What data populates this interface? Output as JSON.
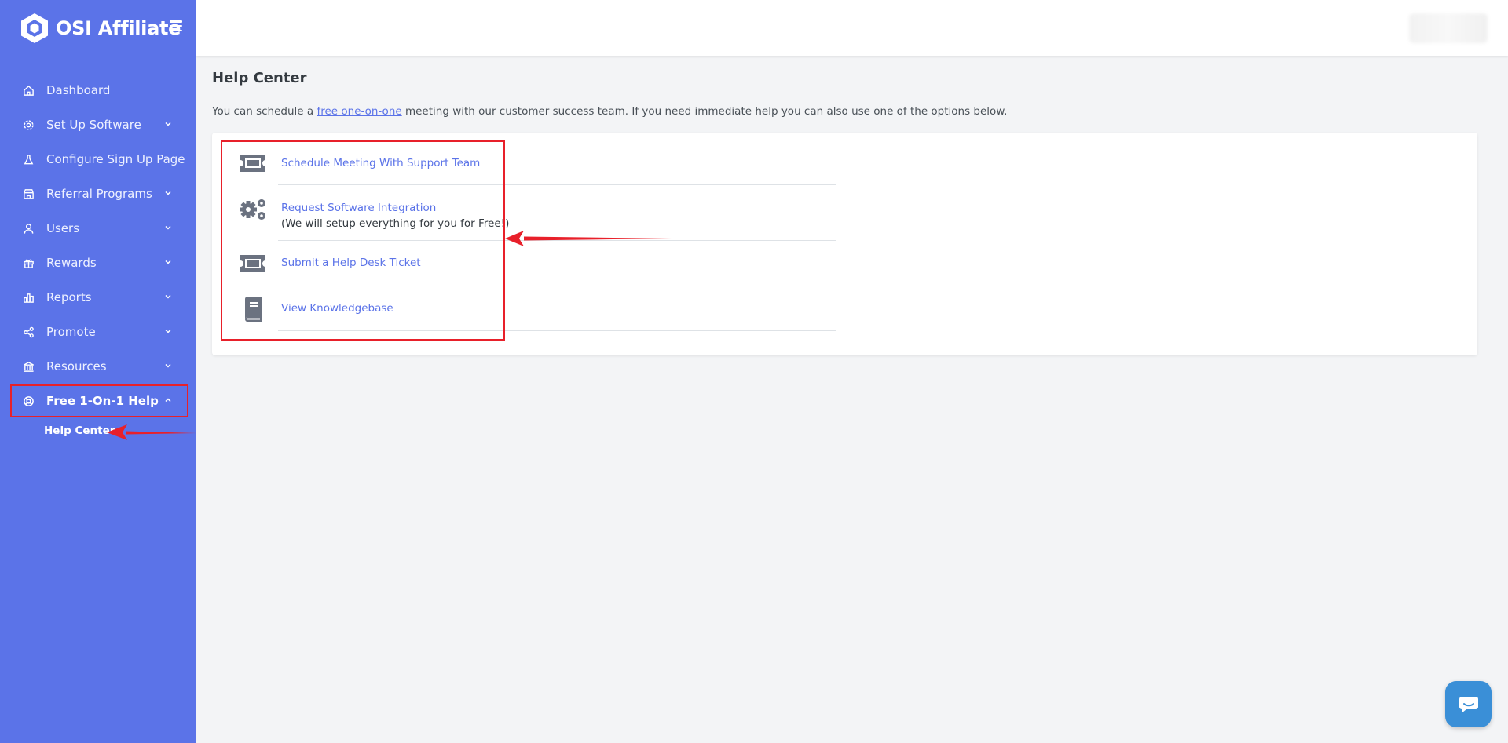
{
  "brand": {
    "name": "OSI Affiliate"
  },
  "sidebar": {
    "items": [
      {
        "label": "Dashboard",
        "icon": "home-icon",
        "has_chevron": false
      },
      {
        "label": "Set Up Software",
        "icon": "gear-icon",
        "has_chevron": true
      },
      {
        "label": "Configure Sign Up Page",
        "icon": "flask-icon",
        "has_chevron": false
      },
      {
        "label": "Referral Programs",
        "icon": "store-icon",
        "has_chevron": true
      },
      {
        "label": "Users",
        "icon": "user-icon",
        "has_chevron": true
      },
      {
        "label": "Rewards",
        "icon": "gift-icon",
        "has_chevron": true
      },
      {
        "label": "Reports",
        "icon": "bar-chart-icon",
        "has_chevron": true
      },
      {
        "label": "Promote",
        "icon": "share-icon",
        "has_chevron": true
      },
      {
        "label": "Resources",
        "icon": "bank-icon",
        "has_chevron": true
      },
      {
        "label": "Free 1-On-1 Help",
        "icon": "lifebuoy-icon",
        "has_chevron": true,
        "expanded": true
      }
    ],
    "sub_items": [
      {
        "label": "Help Center"
      }
    ]
  },
  "main": {
    "title": "Help Center",
    "intro": {
      "before": "You can schedule a ",
      "link": "free one-on-one",
      "after": " meeting with our customer success team. If you need immediate help you can also use one of the options below."
    },
    "options": [
      {
        "label": "Schedule Meeting With Support Team",
        "icon": "ticket-icon"
      },
      {
        "label": "Request Software Integration",
        "sublabel": "(We will setup everything for you for Free!)",
        "icon": "gears-icon"
      },
      {
        "label": "Submit a Help Desk Ticket",
        "icon": "ticket-icon"
      },
      {
        "label": "View Knowledgebase",
        "icon": "book-icon"
      }
    ]
  },
  "colors": {
    "sidebar_bg": "#5b73e8",
    "link": "#5b73e8",
    "annotation_red": "#e8202a",
    "chat_button": "#3a8fd7"
  }
}
